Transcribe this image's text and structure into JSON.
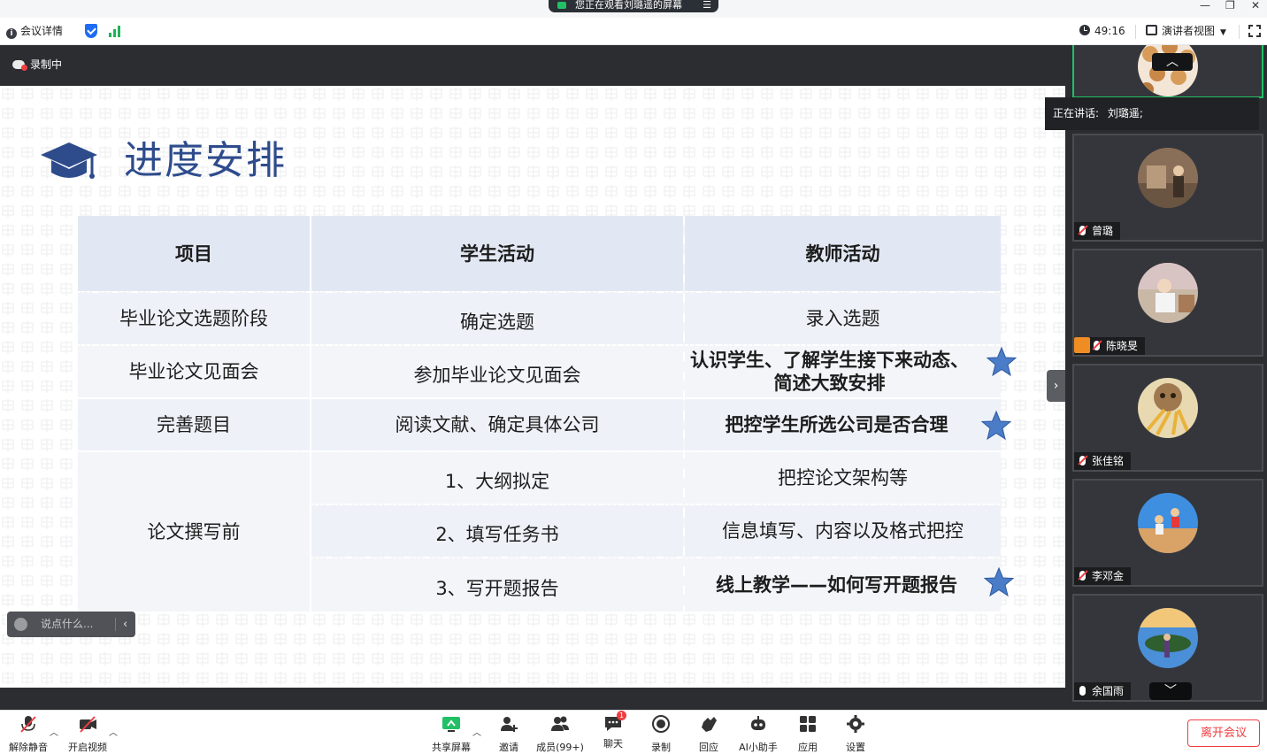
{
  "window": {
    "share_banner": "您正在观看刘璐遥的屏幕",
    "share_menu_icon": "menu-icon"
  },
  "info_bar": {
    "meeting_details": "会议详情",
    "timer": "49:16",
    "view_mode": "演讲者视图"
  },
  "recording": {
    "label": "录制中"
  },
  "slide": {
    "title": "进度安排",
    "table": {
      "headers": [
        "项目",
        "学生活动",
        "教师活动"
      ],
      "rows": [
        {
          "item": "毕业论文选题阶段",
          "student": "确定选题",
          "teacher": "录入选题",
          "starred": false
        },
        {
          "item": "毕业论文见面会",
          "student": "参加毕业论文见面会",
          "teacher": "认识学生、了解学生接下来动态、简述大致安排",
          "starred": true
        },
        {
          "item": "完善题目",
          "student": "阅读文献、确定具体公司",
          "teacher": "把控学生所选公司是否合理",
          "starred": true
        },
        {
          "item": "论文撰写前",
          "student": "1、大纲拟定",
          "teacher": "把控论文架构等",
          "starred": false
        },
        {
          "item": "",
          "student": "2、填写任务书",
          "teacher": "信息填写、内容以及格式把控",
          "starred": false
        },
        {
          "item": "",
          "student": "3、写开题报告",
          "teacher": "线上教学——如何写开题报告",
          "starred": true
        }
      ]
    }
  },
  "chat": {
    "placeholder": "说点什么..."
  },
  "speaking": {
    "label": "正在讲话:",
    "name": "刘璐遥;"
  },
  "participants": [
    {
      "name": "刘璐遥",
      "active": true
    },
    {
      "name": "曾璐",
      "mic": "off"
    },
    {
      "name": "陈晓旻",
      "mic": "off",
      "badge": "user-icon"
    },
    {
      "name": "张佳铭",
      "mic": "off"
    },
    {
      "name": "李邓金",
      "mic": "off"
    },
    {
      "name": "余国雨",
      "mic": "on"
    }
  ],
  "toolbar": {
    "unmute": "解除静音",
    "start_video": "开启视频",
    "share_screen": "共享屏幕",
    "invite": "邀请",
    "members": "成员(99+)",
    "chat": "聊天",
    "chat_badge": "1",
    "record": "录制",
    "reactions": "回应",
    "ai_assistant": "AI小助手",
    "apps": "应用",
    "settings": "设置",
    "leave": "离开会议"
  },
  "colors": {
    "accent_green": "#21c065",
    "leave_red": "#ef3e42",
    "slide_title": "#2e4c8c",
    "star_blue": "#4a7cc7",
    "panel_bg": "#2b2d31"
  }
}
